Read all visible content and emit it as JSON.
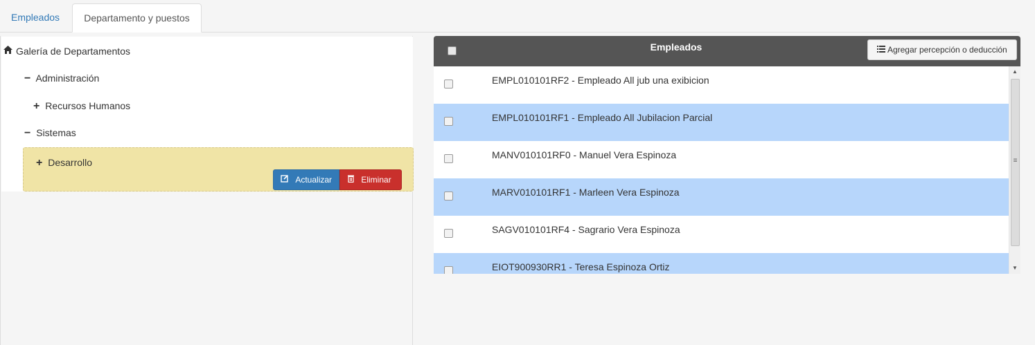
{
  "tabs": [
    {
      "label": "Empleados"
    },
    {
      "label": "Departamento y puestos"
    }
  ],
  "tree": {
    "root_label": "Galería de Departamentos",
    "nodes": [
      {
        "label": "Administración",
        "expander": "−"
      },
      {
        "label": "Recursos Humanos",
        "expander": "+"
      },
      {
        "label": "Sistemas",
        "expander": "−"
      },
      {
        "label": "Desarrollo",
        "expander": "+"
      }
    ],
    "actions": {
      "update_label": "Actualizar",
      "delete_label": "Eliminar"
    }
  },
  "employees_panel": {
    "title": "Empleados",
    "add_button_label": "Agregar percepción o deducción",
    "rows": [
      {
        "label": "EMPL010101RF2 - Empleado All jub una exibicion"
      },
      {
        "label": "EMPL010101RF1 - Empleado All Jubilacion Parcial"
      },
      {
        "label": "MANV010101RF0 - Manuel Vera Espinoza"
      },
      {
        "label": "MARV010101RF1 - Marleen Vera Espinoza"
      },
      {
        "label": "SAGV010101RF4 - Sagrario Vera Espinoza"
      },
      {
        "label": "EIOT900930RR1 - Teresa Espinoza Ortiz"
      }
    ]
  },
  "colors": {
    "active_link": "#337ab7",
    "selected_node_bg": "#f0e4a6",
    "alt_row_bg": "#b7d6fb",
    "header_bg": "#555555",
    "update_button": "#337ab7",
    "delete_button": "#c9302c"
  },
  "icons": {
    "root": "home-icon",
    "update": "edit-icon",
    "delete": "trash-icon",
    "add": "list-icon"
  }
}
